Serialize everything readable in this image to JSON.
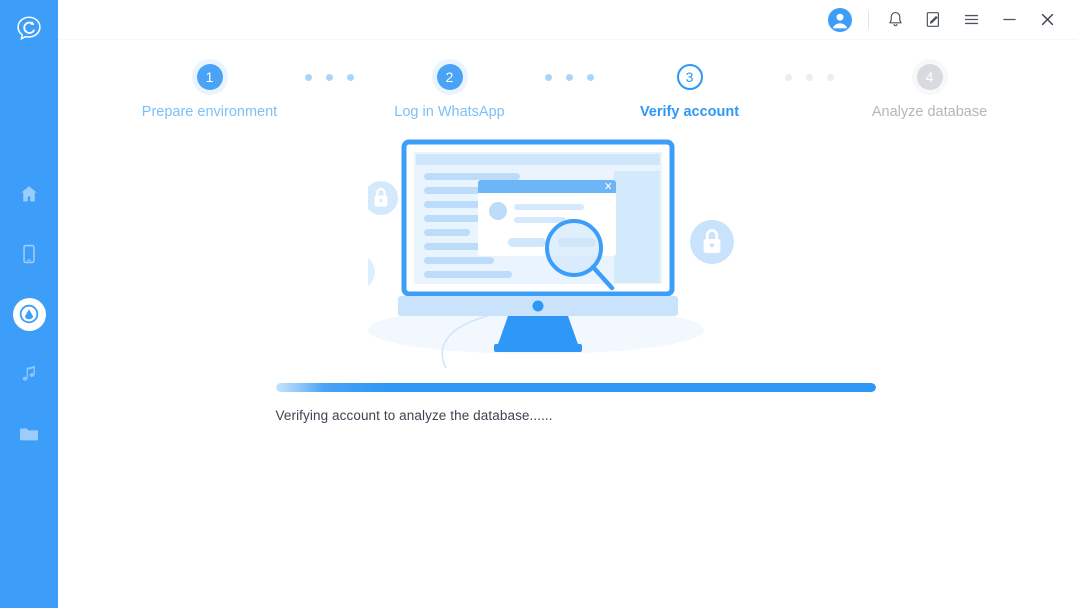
{
  "app": {
    "logo_icon": "chat-refresh-logo-icon",
    "accent_color": "#2f97f7",
    "sidebar_color": "#3c9ef8"
  },
  "sidebar": {
    "items": [
      {
        "name": "home",
        "icon": "home-icon",
        "active": false
      },
      {
        "name": "device",
        "icon": "phone-icon",
        "active": false
      },
      {
        "name": "recover",
        "icon": "droplet-shield-icon",
        "active": true
      },
      {
        "name": "music",
        "icon": "music-note-icon",
        "active": false
      },
      {
        "name": "files",
        "icon": "folder-icon",
        "active": false
      }
    ]
  },
  "titlebar": {
    "buttons": [
      {
        "name": "account",
        "icon": "user-avatar-icon",
        "label": ""
      },
      {
        "name": "notifications",
        "icon": "bell-icon",
        "label": ""
      },
      {
        "name": "feedback",
        "icon": "note-edit-icon",
        "label": ""
      },
      {
        "name": "menu",
        "icon": "hamburger-menu-icon",
        "label": ""
      },
      {
        "name": "minimize",
        "icon": "minimize-icon",
        "label": ""
      },
      {
        "name": "close",
        "icon": "close-icon",
        "label": ""
      }
    ]
  },
  "stepper": {
    "steps": [
      {
        "number": "1",
        "label": "Prepare environment",
        "state": "done"
      },
      {
        "number": "2",
        "label": "Log in WhatsApp",
        "state": "done"
      },
      {
        "number": "3",
        "label": "Verify account",
        "state": "current"
      },
      {
        "number": "4",
        "label": "Analyze database",
        "state": "todo"
      }
    ]
  },
  "illustration": {
    "name": "computer-search-illustration",
    "badges": [
      "lock-icon",
      "bar-chart-icon",
      "lock-icon"
    ]
  },
  "progress": {
    "percent": 100,
    "status_text": "Verifying account to analyze the database......"
  }
}
